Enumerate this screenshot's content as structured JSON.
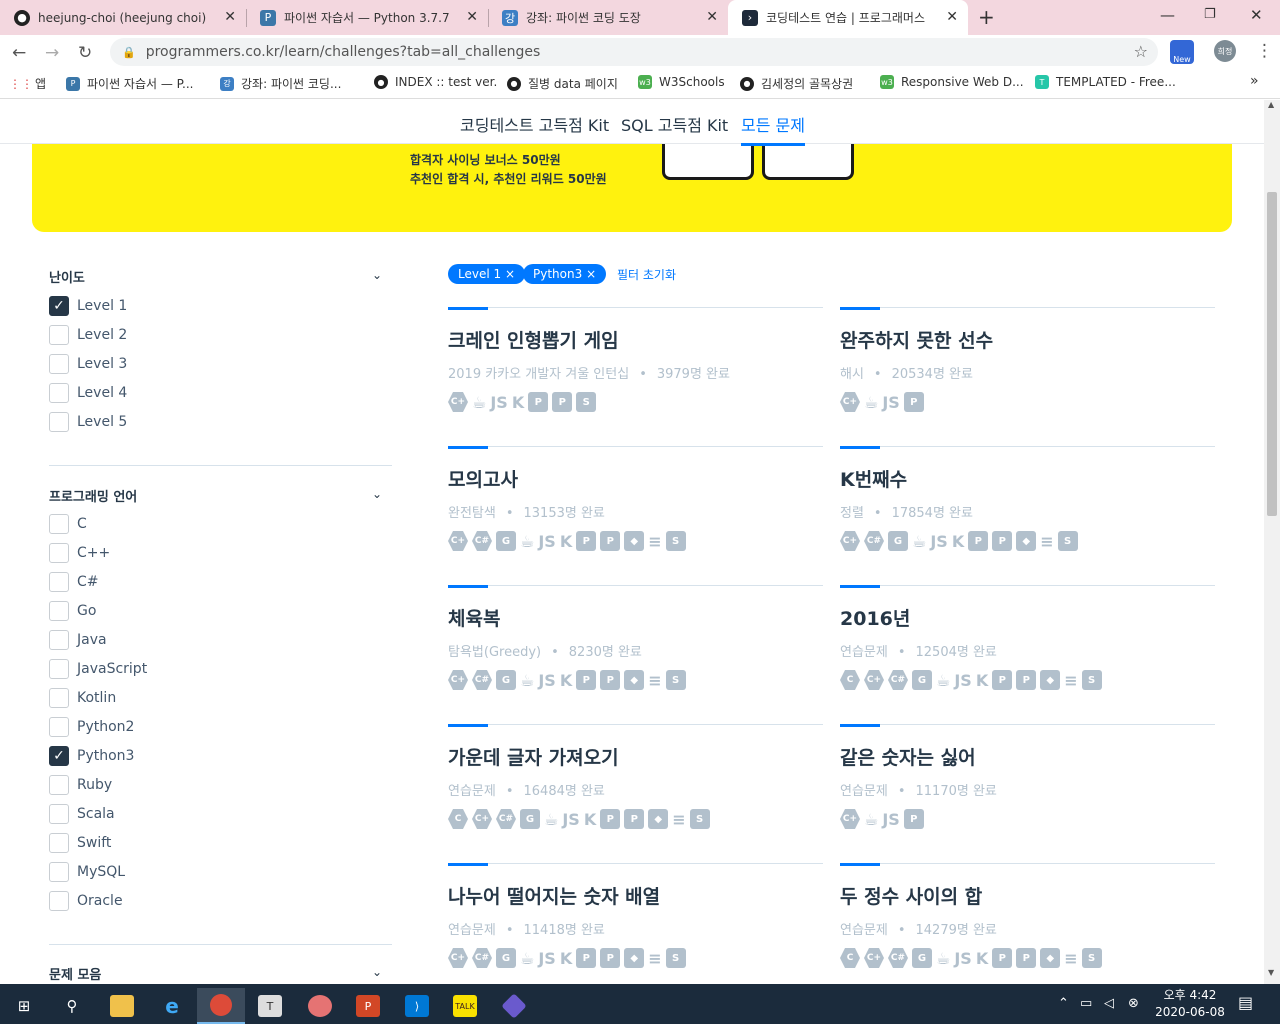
{
  "browser": {
    "tabs": [
      {
        "title": "heejung-choi (heejung choi)",
        "icon": "github-icon"
      },
      {
        "title": "파이썬 자습서 — Python 3.7.7 문서",
        "icon": "python-icon"
      },
      {
        "title": "강좌: 파이썬 코딩 도장",
        "icon": "dojang-icon"
      },
      {
        "title": "코딩테스트 연습 | 프로그래머스",
        "icon": "programmers-icon"
      }
    ],
    "url": "programmers.co.kr/learn/challenges?tab=all_challenges",
    "ext_label": "New",
    "profile_label": "희정",
    "bookmarks": [
      "앱",
      "파이썬 자습서 — P...",
      "강좌: 파이썬 코딩...",
      "INDEX :: test ver.",
      "질병 data 페이지",
      "W3Schools",
      "김세정의 골목상권",
      "Responsive Web D...",
      "TEMPLATED - Free..."
    ],
    "more": "»"
  },
  "subnav": [
    "코딩테스트 고득점 Kit",
    "SQL 고득점 Kit",
    "모든 문제"
  ],
  "banner": {
    "line1": "합격자 사이닝 보너스 50만원",
    "line2": "추천인 합격 시, 추천인 리워드 50만원"
  },
  "sidebar": {
    "difficulty": {
      "title": "난이도",
      "items": [
        {
          "label": "Level 1",
          "checked": true
        },
        {
          "label": "Level 2",
          "checked": false
        },
        {
          "label": "Level 3",
          "checked": false
        },
        {
          "label": "Level 4",
          "checked": false
        },
        {
          "label": "Level 5",
          "checked": false
        }
      ]
    },
    "language": {
      "title": "프로그래밍 언어",
      "items": [
        {
          "label": "C",
          "checked": false
        },
        {
          "label": "C++",
          "checked": false
        },
        {
          "label": "C#",
          "checked": false
        },
        {
          "label": "Go",
          "checked": false
        },
        {
          "label": "Java",
          "checked": false
        },
        {
          "label": "JavaScript",
          "checked": false
        },
        {
          "label": "Kotlin",
          "checked": false
        },
        {
          "label": "Python2",
          "checked": false
        },
        {
          "label": "Python3",
          "checked": true
        },
        {
          "label": "Ruby",
          "checked": false
        },
        {
          "label": "Scala",
          "checked": false
        },
        {
          "label": "Swift",
          "checked": false
        },
        {
          "label": "MySQL",
          "checked": false
        },
        {
          "label": "Oracle",
          "checked": false
        }
      ]
    },
    "collection": {
      "title": "문제 모음"
    }
  },
  "filters": {
    "chips": [
      "Level 1",
      "Python3"
    ],
    "remove_glyph": "×",
    "reset": "필터 초기화"
  },
  "problems": [
    {
      "title": "크레인 인형뽑기 게임",
      "category": "2019 카카오 개발자 겨울 인턴십",
      "count": "3979명 완료",
      "langs": [
        "c++",
        "java",
        "js",
        "kotlin",
        "python2",
        "python3",
        "swift"
      ]
    },
    {
      "title": "완주하지 못한 선수",
      "category": "해시",
      "count": "20534명 완료",
      "langs": [
        "c++",
        "java",
        "js",
        "python3"
      ]
    },
    {
      "title": "모의고사",
      "category": "완전탐색",
      "count": "13153명 완료",
      "langs": [
        "c++",
        "c#",
        "go",
        "java",
        "js",
        "kotlin",
        "python2",
        "python3",
        "ruby",
        "scala",
        "swift"
      ]
    },
    {
      "title": "K번째수",
      "category": "정렬",
      "count": "17854명 완료",
      "langs": [
        "c++",
        "c#",
        "go",
        "java",
        "js",
        "kotlin",
        "python2",
        "python3",
        "ruby",
        "scala",
        "swift"
      ]
    },
    {
      "title": "체육복",
      "category": "탐욕법(Greedy)",
      "count": "8230명 완료",
      "langs": [
        "c++",
        "c#",
        "go",
        "java",
        "js",
        "kotlin",
        "python2",
        "python3",
        "ruby",
        "scala",
        "swift"
      ]
    },
    {
      "title": "2016년",
      "category": "연습문제",
      "count": "12504명 완료",
      "langs": [
        "c",
        "c++",
        "c#",
        "go",
        "java",
        "js",
        "kotlin",
        "python2",
        "python3",
        "ruby",
        "scala",
        "swift"
      ]
    },
    {
      "title": "가운데 글자 가져오기",
      "category": "연습문제",
      "count": "16484명 완료",
      "langs": [
        "c",
        "c++",
        "c#",
        "go",
        "java",
        "js",
        "kotlin",
        "python2",
        "python3",
        "ruby",
        "scala",
        "swift"
      ]
    },
    {
      "title": "같은 숫자는 싫어",
      "category": "연습문제",
      "count": "11170명 완료",
      "langs": [
        "c++",
        "java",
        "js",
        "python3"
      ]
    },
    {
      "title": "나누어 떨어지는 숫자 배열",
      "category": "연습문제",
      "count": "11418명 완료",
      "langs": [
        "c++",
        "c#",
        "go",
        "java",
        "js",
        "kotlin",
        "python2",
        "python3",
        "ruby",
        "scala",
        "swift"
      ]
    },
    {
      "title": "두 정수 사이의 합",
      "category": "연습문제",
      "count": "14279명 완료",
      "langs": [
        "c",
        "c++",
        "c#",
        "go",
        "java",
        "js",
        "kotlin",
        "python2",
        "python3",
        "ruby",
        "scala",
        "swift"
      ]
    }
  ],
  "taskbar": {
    "time": "오후 4:42",
    "date": "2020-06-08"
  },
  "colors": {
    "accent": "#0078ff",
    "banner": "#fff20e",
    "text": "#263747",
    "muted": "#b2c0cc"
  }
}
